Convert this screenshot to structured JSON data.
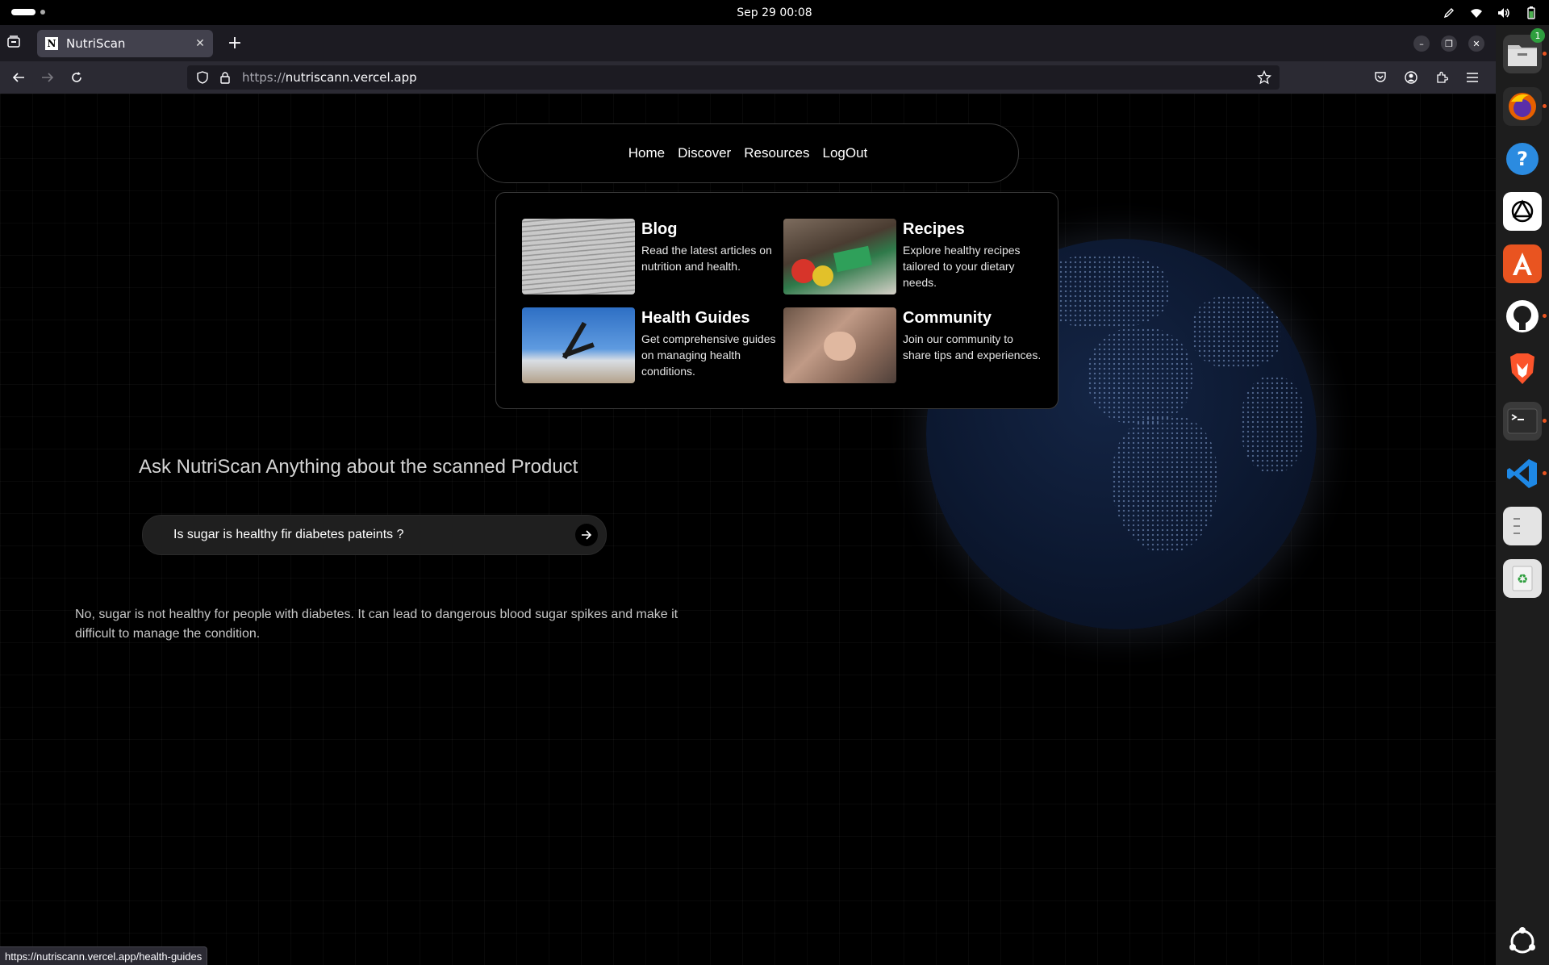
{
  "system": {
    "clock": "Sep 29  00:08"
  },
  "browser": {
    "tab_title": "NutriScan",
    "tab_favicon": "N",
    "url_protocol": "https://",
    "url_host": "nutriscann.vercel.app",
    "status_url": "https://nutriscann.vercel.app/health-guides"
  },
  "dock": {
    "files_badge": "1"
  },
  "site": {
    "nav": [
      "Home",
      "Discover",
      "Resources",
      "LogOut"
    ],
    "menu": [
      {
        "title": "Blog",
        "desc": "Read the latest articles on nutrition and health."
      },
      {
        "title": "Recipes",
        "desc": "Explore healthy recipes tailored to your dietary needs."
      },
      {
        "title": "Health Guides",
        "desc": "Get comprehensive guides on managing health conditions."
      },
      {
        "title": "Community",
        "desc": "Join our community to share tips and experiences."
      }
    ],
    "ask_title": "Ask NutriScan Anything about the scanned Product",
    "query": "Is sugar is healthy fir diabetes pateints ?",
    "answer": "No, sugar is not healthy for people with diabetes. It can lead to dangerous blood sugar spikes and make it difficult to manage the condition."
  }
}
